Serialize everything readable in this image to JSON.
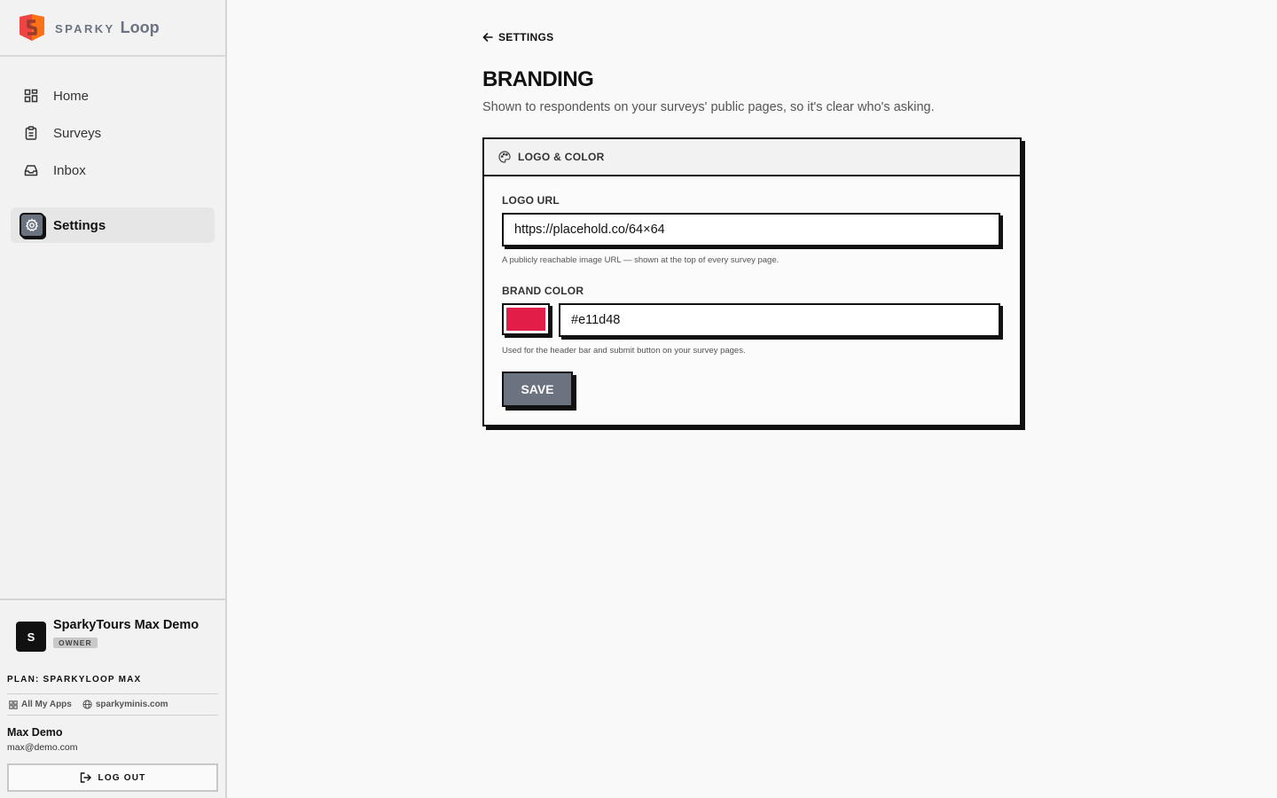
{
  "brand": {
    "word1": "SPARKY",
    "word2": "Loop",
    "logo_colors": [
      "#ef4444",
      "#f97316",
      "#fb923c"
    ]
  },
  "nav": {
    "items": [
      {
        "label": "Home",
        "icon": "grid-icon"
      },
      {
        "label": "Surveys",
        "icon": "clipboard-icon"
      },
      {
        "label": "Inbox",
        "icon": "inbox-icon"
      }
    ],
    "active": {
      "label": "Settings",
      "icon": "gear-icon"
    }
  },
  "account": {
    "avatar_letter": "S",
    "org_name": "SparkyTours Max Demo",
    "role": "OWNER",
    "plan": "PLAN: SPARKYLOOP MAX",
    "links": [
      {
        "label": "All My Apps",
        "icon": "grid-icon"
      },
      {
        "label": "sparkyminis.com",
        "icon": "globe-icon"
      }
    ],
    "user_name": "Max Demo",
    "user_email": "max@demo.com",
    "logout_label": "LOG OUT"
  },
  "page": {
    "back_label": "SETTINGS",
    "title": "BRANDING",
    "subtitle": "Shown to respondents on your surveys' public pages, so it's clear who's asking."
  },
  "card": {
    "header": "LOGO & COLOR",
    "logo_label": "LOGO URL",
    "logo_value": "https://placehold.co/64×64",
    "logo_help": "A publicly reachable image URL — shown at the top of every survey page.",
    "color_label": "BRAND COLOR",
    "color_value": "#e11d48",
    "color_help": "Used for the header bar and submit button on your survey pages.",
    "save_label": "SAVE"
  },
  "colors": {
    "accent": "#6b7280",
    "brand_color": "#e11d48",
    "border": "#111111"
  }
}
